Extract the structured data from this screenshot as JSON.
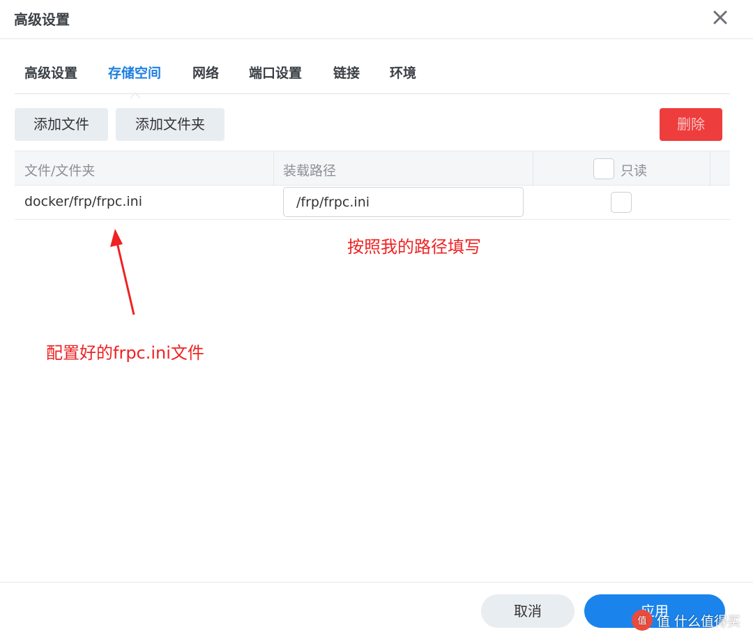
{
  "dialog": {
    "title": "高级设置"
  },
  "tabs": [
    {
      "label": "高级设置",
      "active": false
    },
    {
      "label": "存储空间",
      "active": true
    },
    {
      "label": "网络",
      "active": false
    },
    {
      "label": "端口设置",
      "active": false
    },
    {
      "label": "链接",
      "active": false
    },
    {
      "label": "环境",
      "active": false
    }
  ],
  "toolbar": {
    "add_file_label": "添加文件",
    "add_folder_label": "添加文件夹",
    "delete_label": "删除"
  },
  "table": {
    "headers": {
      "file": "文件/文件夹",
      "mount_path": "装载路径",
      "readonly": "只读"
    },
    "rows": [
      {
        "file": "docker/frp/frpc.ini",
        "mount_path": "/frp/frpc.ini",
        "readonly": false
      }
    ]
  },
  "annotations": {
    "path_note": "按照我的路径填写",
    "file_note": "配置好的frpc.ini文件"
  },
  "footer": {
    "cancel_label": "取消",
    "apply_label": "应用"
  },
  "watermark": {
    "text": "值 什么值得买"
  },
  "colors": {
    "accent": "#1d7fe0",
    "apply_button": "#1a84ec",
    "delete_button": "#ee3d3d",
    "annotation": "#ee2222"
  },
  "icons": {
    "close": "close-icon",
    "watermark_logo": "smzdm-logo-icon"
  }
}
